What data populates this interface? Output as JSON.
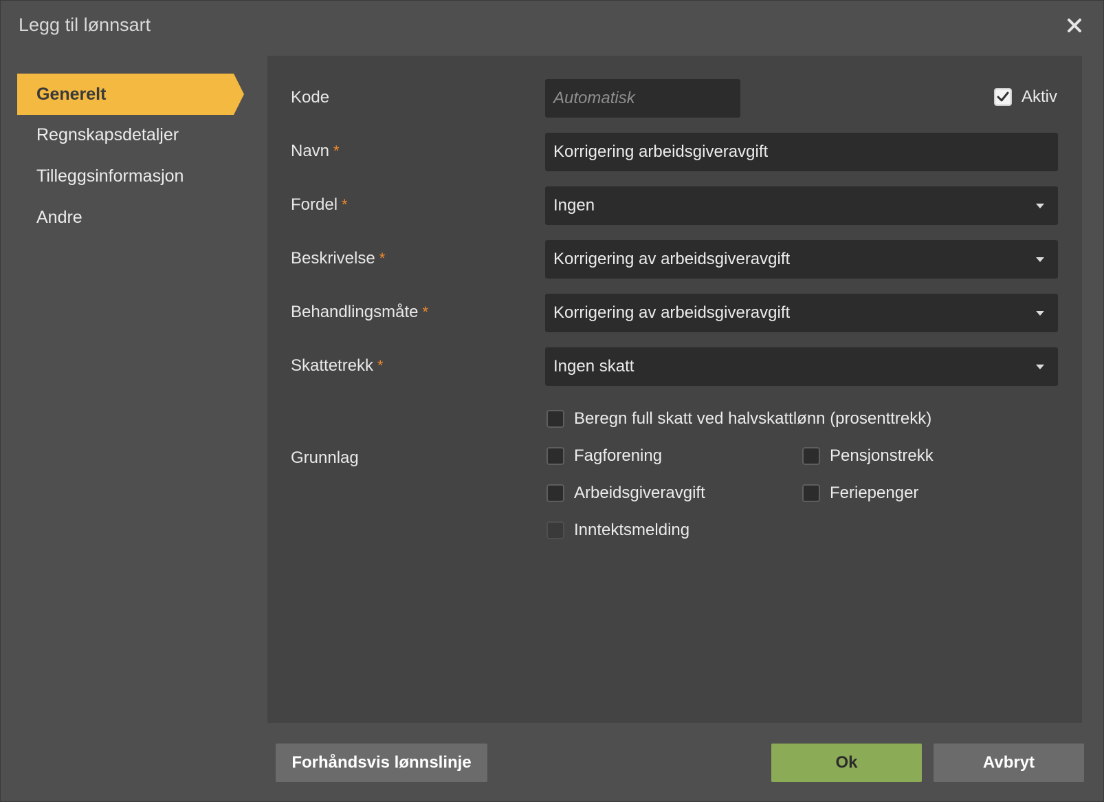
{
  "dialog": {
    "title": "Legg til lønnsart",
    "close_icon": "close-icon"
  },
  "nav": {
    "items": [
      {
        "label": "Generelt",
        "active": true
      },
      {
        "label": "Regnskapsdetaljer",
        "active": false
      },
      {
        "label": "Tilleggsinformasjon",
        "active": false
      },
      {
        "label": "Andre",
        "active": false
      }
    ]
  },
  "form": {
    "kode": {
      "label": "Kode",
      "value": "",
      "placeholder": "Automatisk"
    },
    "aktiv": {
      "label": "Aktiv",
      "checked": true
    },
    "navn": {
      "label": "Navn",
      "required_mark": "*",
      "value": "Korrigering arbeidsgiveravgift"
    },
    "fordel": {
      "label": "Fordel",
      "required_mark": "*",
      "value": "Ingen"
    },
    "beskrivelse": {
      "label": "Beskrivelse",
      "required_mark": "*",
      "value": "Korrigering av arbeidsgiveravgift"
    },
    "behandlingsmate": {
      "label": "Behandlingsmåte",
      "required_mark": "*",
      "value": "Korrigering av arbeidsgiveravgift"
    },
    "skattetrekk": {
      "label": "Skattetrekk",
      "required_mark": "*",
      "value": "Ingen skatt"
    },
    "full_skatt": {
      "label": "Beregn full skatt ved halvskattlønn (prosenttrekk)",
      "checked": false
    },
    "grunnlag": {
      "label": "Grunnlag",
      "options": [
        {
          "label": "Fagforening",
          "checked": false,
          "enabled": true
        },
        {
          "label": "Pensjonstrekk",
          "checked": false,
          "enabled": true
        },
        {
          "label": "Arbeidsgiveravgift",
          "checked": false,
          "enabled": true
        },
        {
          "label": "Feriepenger",
          "checked": false,
          "enabled": true
        },
        {
          "label": "Inntektsmelding",
          "checked": false,
          "enabled": false
        }
      ]
    }
  },
  "buttons": {
    "preview": "Forhåndsvis lønnslinje",
    "ok": "Ok",
    "cancel": "Avbryt"
  },
  "colors": {
    "accent": "#f3b941",
    "required": "#ee8a2a",
    "ok_button": "#8bab56",
    "dialog_bg": "#4f4f4f",
    "panel_bg": "#444444",
    "field_bg": "#2c2c2c"
  }
}
